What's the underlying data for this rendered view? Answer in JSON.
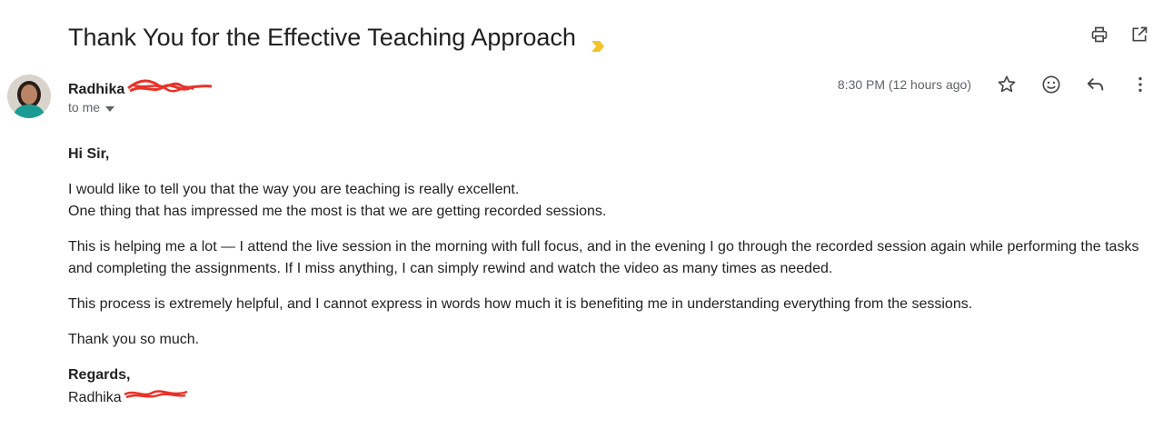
{
  "email": {
    "subject": "Thank You for the Effective Teaching Approach",
    "sender_name": "Radhika",
    "recipient_label": "to me",
    "timestamp": "8:30 PM (12 hours ago)",
    "greeting": "Hi Sir,",
    "paragraph1_line1": "I would like to tell you that the way you are teaching is really excellent.",
    "paragraph1_line2": "One thing that has impressed me the most is that we are getting recorded sessions.",
    "paragraph2": "This is helping me a lot — I attend the live session in the morning with full focus, and in the evening I go through the recorded session again while performing the tasks and completing the assignments. If I miss anything, I can simply rewind and watch the video as many times as needed.",
    "paragraph3": "This process is extremely helpful, and I cannot express in words how much it is benefiting me in understanding everything from the sessions.",
    "paragraph4": "Thank you so much.",
    "regards": "Regards,",
    "signature_name": "Radhika"
  },
  "icons": {
    "important": "important-marker-icon",
    "print": "print-icon",
    "open_new_window": "open-in-new-window-icon",
    "star": "star-icon",
    "emoji": "emoji-reaction-icon",
    "reply": "reply-icon",
    "more": "more-vertical-icon",
    "recipient_dropdown": "chevron-down-icon"
  },
  "colors": {
    "important_marker": "#f2c42c",
    "redaction": "#e8332a",
    "secondary_text": "#5f6368",
    "avatar_teal": "#1a9c94"
  }
}
